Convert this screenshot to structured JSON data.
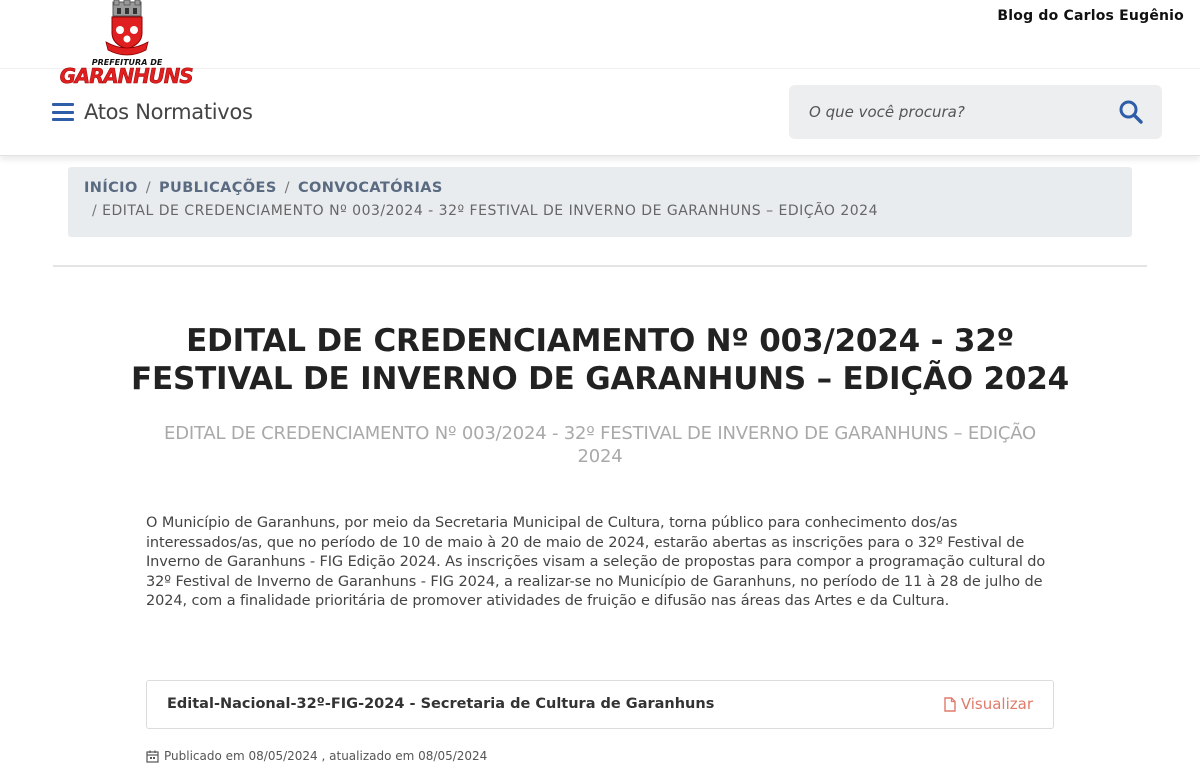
{
  "watermark": "Blog do Carlos Eugênio",
  "logo": {
    "top_text": "PREFEITURA DE",
    "name": "GARANHUNS",
    "colors": {
      "red": "#e02020",
      "gray": "#8a8a8a"
    }
  },
  "header": {
    "menu_label": "Atos Normativos",
    "menu_icon": "hamburger-icon",
    "search_placeholder": "O que você procura?",
    "search_icon": "search-icon"
  },
  "breadcrumb": {
    "items": [
      "INÍCIO",
      "PUBLICAÇÕES",
      "CONVOCATÓRIAS"
    ],
    "current": "EDITAL DE CREDENCIAMENTO Nº 003/2024 - 32º FESTIVAL DE INVERNO DE GARANHUNS – EDIÇÃO 2024"
  },
  "article": {
    "title_line1": "EDITAL DE CREDENCIAMENTO Nº 003/2024 - 32º",
    "title_line2": "FESTIVAL DE INVERNO DE GARANHUNS – EDIÇÃO 2024",
    "subtitle": "EDITAL DE CREDENCIAMENTO Nº 003/2024 - 32º FESTIVAL DE INVERNO DE GARANHUNS – EDIÇÃO 2024",
    "body": "O Município de Garanhuns, por meio da Secretaria Municipal de Cultura, torna público para conhecimento dos/as interessados/as, que no período de 10 de maio à 20 de maio de 2024, estarão abertas as inscrições para o 32º Festival de Inverno de Garanhuns - FIG Edição 2024. As inscrições visam a seleção de propostas para compor a programação cultural do 32º Festival de Inverno de Garanhuns - FIG 2024, a realizar-se no Município de Garanhuns, no período de 11 à 28 de julho de 2024, com a finalidade prioritária de promover atividades de fruição e difusão nas áreas das Artes e da Cultura."
  },
  "attachment": {
    "name": "Edital-Nacional-32º-FIG-2024 - Secretaria de Cultura de Garanhuns",
    "view_label": "Visualizar",
    "view_icon": "file-icon",
    "accent": "#e07b6a"
  },
  "meta": {
    "icon": "calendar-icon",
    "text": "Publicado em 08/05/2024 , atualizado em 08/05/2024"
  },
  "colors": {
    "primary": "#2f5ea8",
    "breadcrumb_bg": "#e9ecef",
    "search_bg": "#edeef0"
  }
}
